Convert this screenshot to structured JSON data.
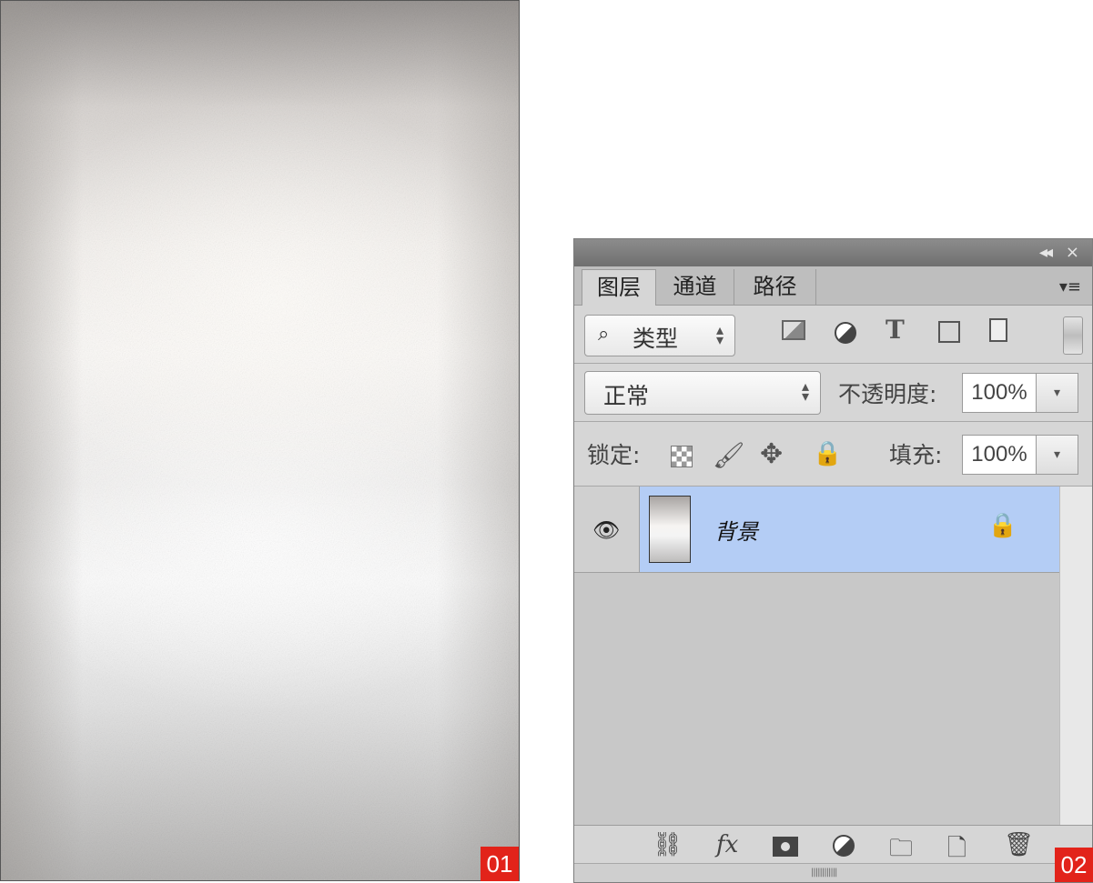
{
  "labels": {
    "canvas_tag": "01",
    "panel_tag": "02"
  },
  "panel": {
    "window_controls": {
      "collapse": "◂◂",
      "close": "×"
    },
    "tabs": [
      {
        "label": "图层",
        "active": true
      },
      {
        "label": "通道",
        "active": false
      },
      {
        "label": "路径",
        "active": false
      }
    ],
    "menu_icon": "▾≡",
    "filter": {
      "value": "类型",
      "icons": [
        "image-filter-icon",
        "adjustment-filter-icon",
        "type-filter-icon",
        "shape-filter-icon",
        "smart-object-filter-icon"
      ],
      "type_icon_glyph": "T"
    },
    "blend": {
      "mode": "正常",
      "opacity_label": "不透明度:",
      "opacity_value": "100%"
    },
    "lock": {
      "label": "锁定:",
      "fill_label": "填充:",
      "fill_value": "100%"
    },
    "layers": [
      {
        "name": "背景",
        "visible": true,
        "locked": true
      }
    ],
    "bottom_icons": [
      "link-icon",
      "fx-icon",
      "mask-icon",
      "adjustment-icon",
      "folder-icon",
      "new-layer-icon",
      "trash-icon"
    ],
    "fx_glyph": "fx"
  },
  "colors": {
    "tag": "#e2231a",
    "selected_layer": "#b4cdf5"
  }
}
